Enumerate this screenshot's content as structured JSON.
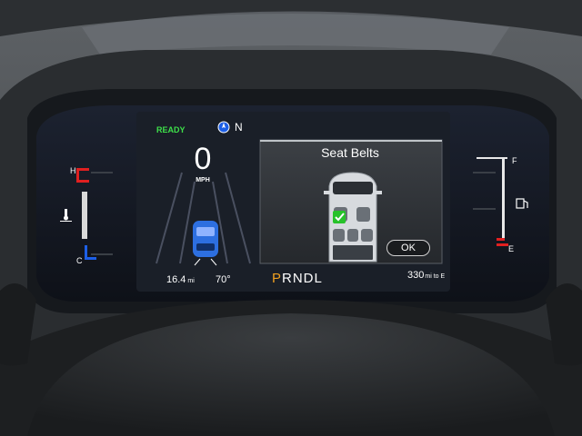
{
  "status": {
    "ready": "READY"
  },
  "compass": {
    "heading": "N"
  },
  "speedometer": {
    "value": "0",
    "unit": "MPH"
  },
  "seatbelt_panel": {
    "title": "Seat Belts",
    "ok_label": "OK"
  },
  "bottom_bar": {
    "trip_value": "16.4",
    "trip_unit": "mi",
    "outside_temp": "70°",
    "gear_selected": "P",
    "gear_rest": "RNDL",
    "range_value": "330",
    "range_unit": "mi to E"
  },
  "fuel_gauge": {
    "full_label": "F",
    "empty_label": "E",
    "level": 0.1
  },
  "temp_gauge": {
    "hot_label": "H",
    "cold_label": "C",
    "level": 0.5
  },
  "icons": [
    "compass-icon",
    "car-top-view-icon",
    "seatbelt-check-icon",
    "fuel-pump-icon",
    "coolant-temp-icon"
  ],
  "colors": {
    "ready": "#3ee04a",
    "gear_selected": "#f0a020",
    "gauge_red": "#e02020",
    "gauge_blue": "#1d5fe6",
    "check_green": "#27c22a"
  }
}
